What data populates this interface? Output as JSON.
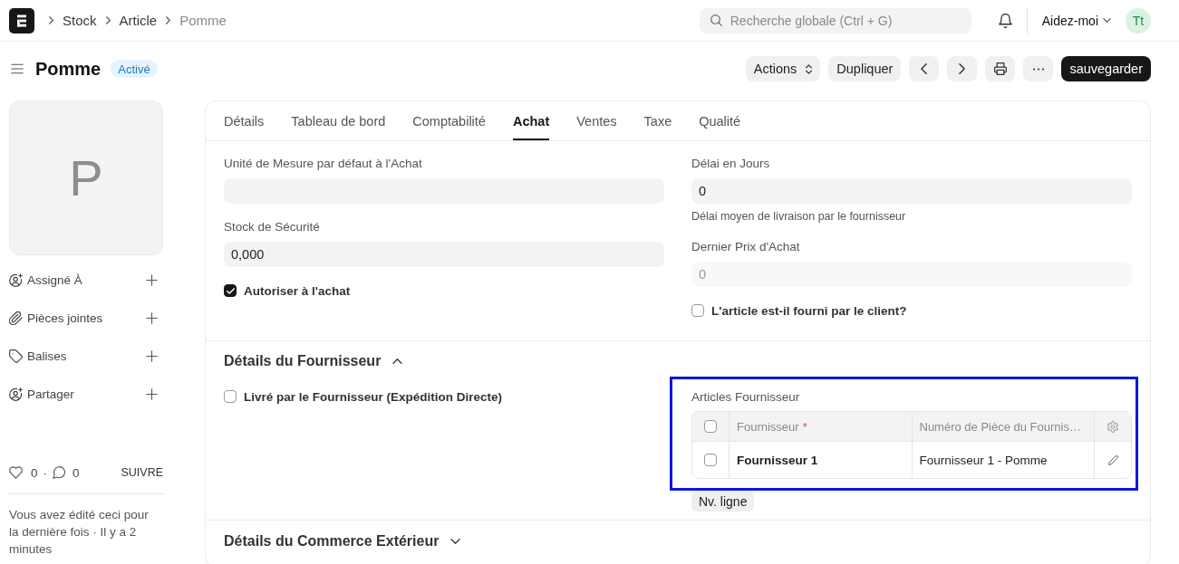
{
  "navbar": {
    "breadcrumbs": [
      {
        "label": "Stock",
        "current": false
      },
      {
        "label": "Article",
        "current": false
      },
      {
        "label": "Pomme",
        "current": true
      }
    ],
    "search": {
      "placeholder": "Recherche globale (Ctrl + G)"
    },
    "help": "Aidez-moi",
    "avatar": "Tt"
  },
  "header": {
    "title": "Pomme",
    "status": "Activé",
    "actions": [
      {
        "kind": "actions_menu",
        "label": "Actions"
      },
      {
        "kind": "duplicate",
        "label": "Dupliquer"
      },
      {
        "kind": "prev"
      },
      {
        "kind": "next"
      },
      {
        "kind": "print"
      },
      {
        "kind": "more"
      },
      {
        "kind": "save",
        "label": "sauvegarder"
      }
    ]
  },
  "sidebar": {
    "image_letter": "P",
    "items": [
      {
        "kind": "assign",
        "label": "Assigné À"
      },
      {
        "kind": "attachment",
        "label": "Pièces jointes"
      },
      {
        "kind": "tag",
        "label": "Balises"
      },
      {
        "kind": "share",
        "label": "Partager"
      }
    ],
    "likes": "0",
    "separator": "·",
    "comments": "0",
    "follow": "SUIVRE",
    "last_edit": "Vous avez édité ceci pour la dernière fois · Il y a 2 minutes"
  },
  "tabs": [
    {
      "label": "Détails",
      "selected": false
    },
    {
      "label": "Tableau de bord",
      "selected": false
    },
    {
      "label": "Comptabilité",
      "selected": false
    },
    {
      "label": "Achat",
      "selected": true
    },
    {
      "label": "Ventes",
      "selected": false
    },
    {
      "label": "Taxe",
      "selected": false
    },
    {
      "label": "Qualité",
      "selected": false
    }
  ],
  "purchase_section": {
    "left": [
      {
        "kind": "input",
        "label": "Unité de Mesure par défaut à l'Achat"
      },
      {
        "kind": "input",
        "label": "Stock de Sécurité",
        "value": "0,000"
      },
      {
        "kind": "checkbox",
        "label": "Autoriser à l'achat",
        "checked": true
      }
    ],
    "right": [
      {
        "kind": "input",
        "label": "Délai en Jours",
        "value": "0",
        "description": "Délai moyen de livraison par le fournisseur"
      },
      {
        "kind": "readonly_input",
        "label": "Dernier Prix d'Achat",
        "value": "0"
      },
      {
        "kind": "checkbox",
        "label": "L'article est-il fourni par le client?",
        "checked": false
      }
    ]
  },
  "supplier_section": {
    "title": "Détails du Fournisseur",
    "expanded": true,
    "left": [
      {
        "kind": "checkbox",
        "label": "Livré par le Fournisseur (Expédition Directe)",
        "checked": false
      }
    ],
    "table": {
      "label": "Articles Fournisseur",
      "highlighted": true,
      "all_selected": false,
      "columns": [
        {
          "label": "Fournisseur",
          "required_mark": "*"
        },
        {
          "label": "Numéro de Pièce du Fournis…"
        }
      ],
      "rows": [
        {
          "selected": false,
          "cells": [
            "Fournisseur 1",
            "Fournisseur 1 - Pomme"
          ]
        }
      ],
      "add_row": "Nv. ligne"
    }
  },
  "foreign_trade_section": {
    "title": "Détails du Commerce Extérieur",
    "expanded": false
  }
}
